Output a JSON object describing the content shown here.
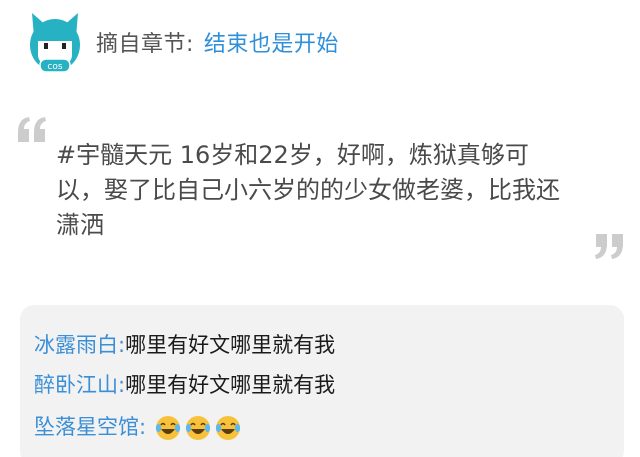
{
  "header": {
    "label": "摘自章节:",
    "chapter": "结束也是开始",
    "avatar_text": "cos"
  },
  "quote": {
    "text": "#宇髓天元 16岁和22岁，好啊，炼狱真够可以，娶了比自己小六岁的的少女做老婆，比我还潇洒"
  },
  "comments": [
    {
      "user": "冰露雨白:",
      "text": "哪里有好文哪里就有我"
    },
    {
      "user": "醉卧江山:",
      "text": "哪里有好文哪里就有我"
    },
    {
      "user": "坠落星空馆:",
      "text": "",
      "emojis": [
        "laughing-crying-emoji",
        "laughing-crying-emoji",
        "laughing-crying-emoji"
      ]
    }
  ],
  "colors": {
    "accent": "#2f8fd8",
    "avatar": "#27b2c4",
    "comment_bg": "#f2f2f2",
    "quote_mark": "#cccccc"
  }
}
